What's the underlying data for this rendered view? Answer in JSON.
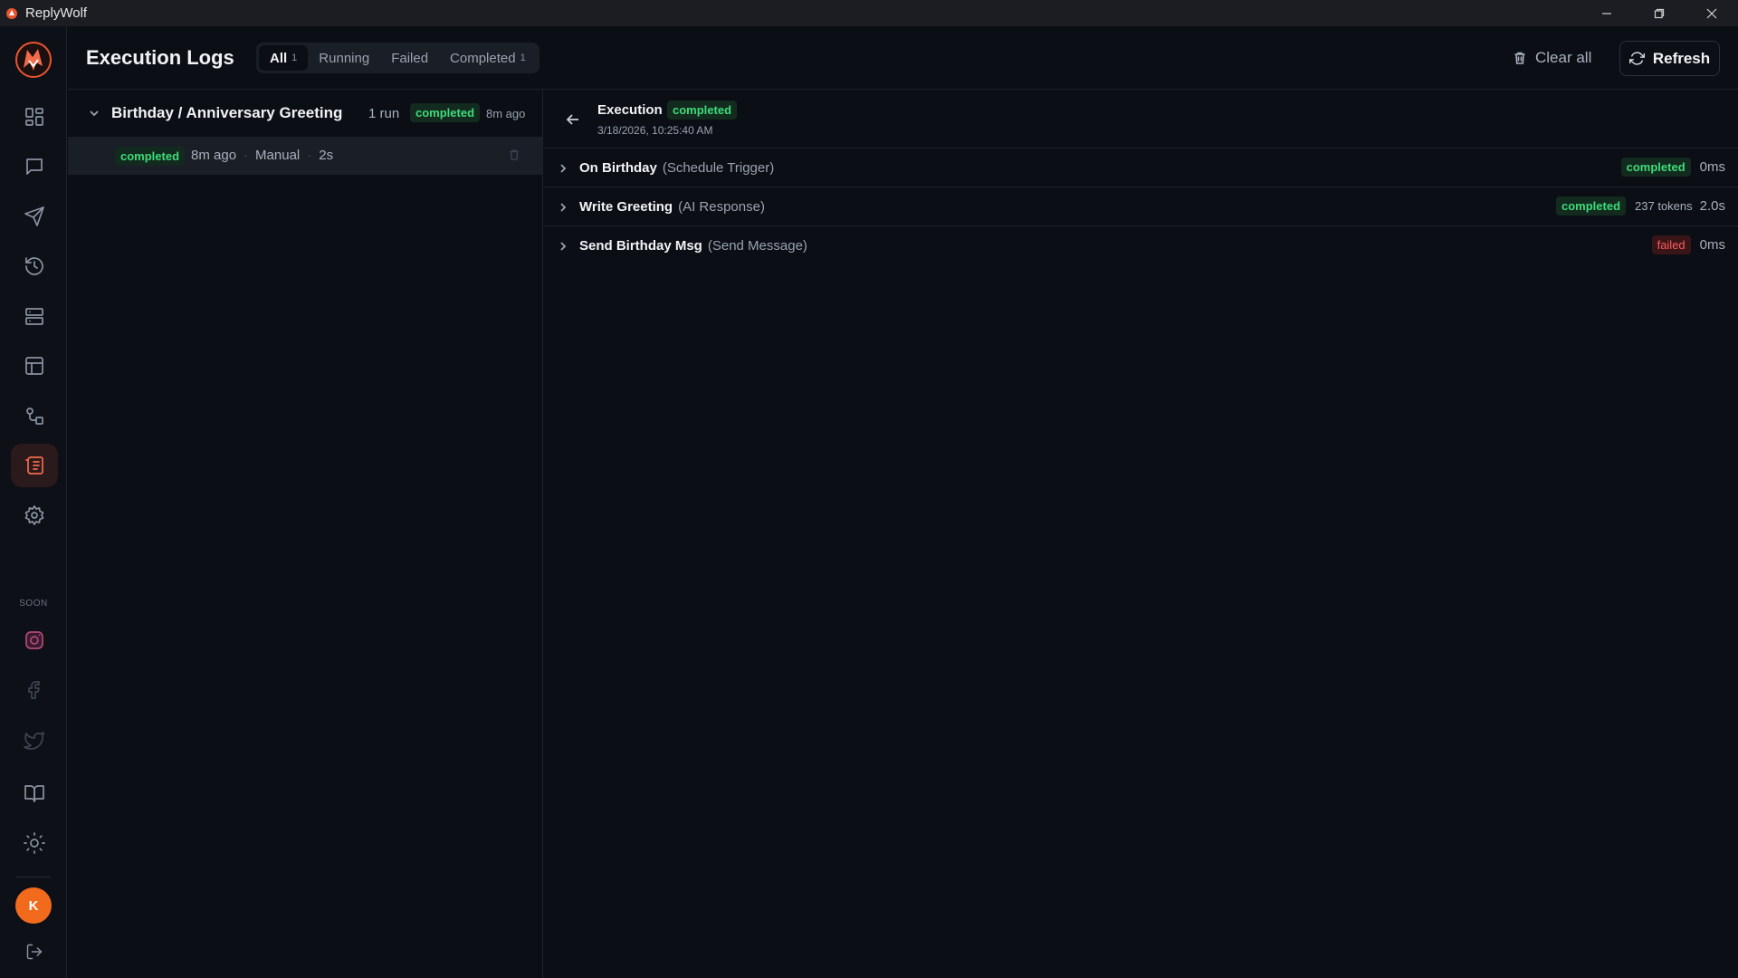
{
  "app": {
    "title": "ReplyWolf"
  },
  "sidebar": {
    "nav": [
      {
        "name": "dashboard-icon"
      },
      {
        "name": "chat-icon"
      },
      {
        "name": "send-icon"
      },
      {
        "name": "history-icon"
      },
      {
        "name": "layout-icon"
      },
      {
        "name": "table-icon"
      },
      {
        "name": "workflow-icon"
      },
      {
        "name": "logs-icon",
        "active": true
      },
      {
        "name": "gear-icon"
      }
    ],
    "soon_label": "SOON",
    "soon": [
      {
        "name": "instagram-icon"
      },
      {
        "name": "facebook-icon"
      },
      {
        "name": "twitter-icon"
      }
    ],
    "bottom": [
      {
        "name": "book-icon"
      },
      {
        "name": "sun-icon"
      }
    ],
    "avatar_initial": "K"
  },
  "header": {
    "title": "Execution Logs",
    "tabs": [
      {
        "label": "All",
        "count": "1",
        "active": true
      },
      {
        "label": "Running",
        "count": ""
      },
      {
        "label": "Failed",
        "count": ""
      },
      {
        "label": "Completed",
        "count": "1"
      }
    ],
    "clear_all": "Clear all",
    "refresh": "Refresh"
  },
  "list": {
    "group": {
      "title": "Birthday / Anniversary Greeting",
      "runs": "1 run",
      "status": "completed",
      "time": "8m ago"
    },
    "run": {
      "status": "completed",
      "time": "8m ago",
      "trigger": "Manual",
      "duration": "2s"
    }
  },
  "execution": {
    "label": "Execution",
    "status": "completed",
    "date": "3/18/2026, 10:25:40 AM",
    "steps": [
      {
        "name": "On Birthday",
        "type": "(Schedule Trigger)",
        "status": "completed",
        "tokens": "",
        "duration": "0ms"
      },
      {
        "name": "Write Greeting",
        "type": "(AI Response)",
        "status": "completed",
        "tokens": "237 tokens",
        "duration": "2.0s"
      },
      {
        "name": "Send Birthday Msg",
        "type": "(Send Message)",
        "status": "failed",
        "tokens": "",
        "duration": "0ms"
      }
    ]
  },
  "colors": {
    "accent": "#f26b4b",
    "success": "#3ddc7a",
    "danger": "#ff5a5f",
    "background": "#0b0e14"
  }
}
